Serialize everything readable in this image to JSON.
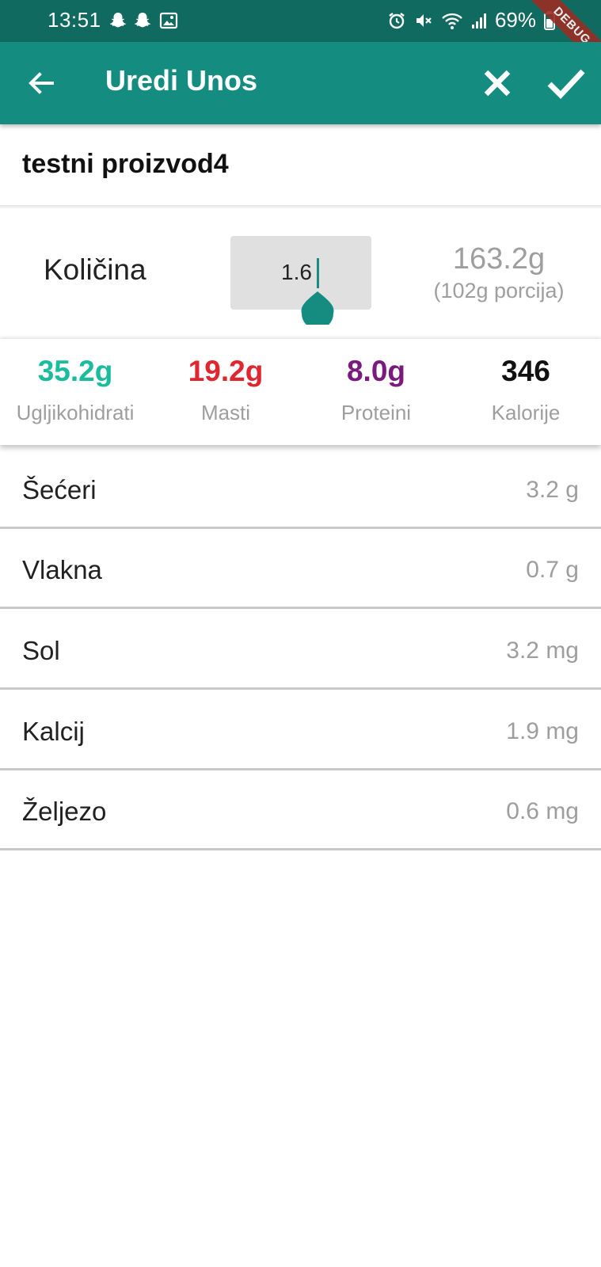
{
  "status_bar": {
    "time": "13:51",
    "battery": "69%",
    "icons": [
      "snapchat-icon",
      "snapchat-icon",
      "gallery-icon",
      "alarm-icon",
      "mute-icon",
      "wifi-icon",
      "signal-icon",
      "battery-icon"
    ],
    "debug_banner": "DEBUG"
  },
  "app_bar": {
    "title": "Uredi Unos",
    "icons": [
      "back-arrow-icon",
      "close-icon",
      "check-icon"
    ],
    "color": "#148d80"
  },
  "product": {
    "name": "testni proizvod4"
  },
  "quantity": {
    "label": "Količina",
    "value": "1.6",
    "grams": "163.2g",
    "portion": "(102g porcija)"
  },
  "macros": [
    {
      "value": "35.2g",
      "label": "Ugljikohidrati",
      "color": "#1abc9c"
    },
    {
      "value": "19.2g",
      "label": "Masti",
      "color": "#e0262e"
    },
    {
      "value": "8.0g",
      "label": "Proteini",
      "color": "#7b1a7e"
    },
    {
      "value": "346",
      "label": "Kalorije",
      "color": "#111111"
    }
  ],
  "nutrients": [
    {
      "name": "Šećeri",
      "value": "3.2 g"
    },
    {
      "name": "Vlakna",
      "value": "0.7 g"
    },
    {
      "name": "Sol",
      "value": "3.2 mg"
    },
    {
      "name": "Kalcij",
      "value": "1.9 mg"
    },
    {
      "name": "Željezo",
      "value": "0.6 mg"
    }
  ]
}
